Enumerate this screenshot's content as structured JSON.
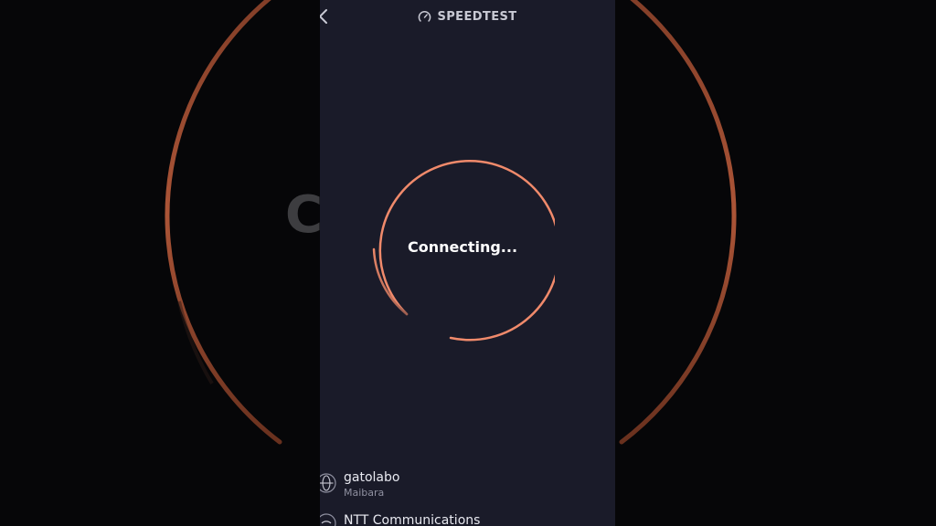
{
  "header": {
    "brand": "SPEEDTEST",
    "back_icon": "chevron-left-icon",
    "logo_icon": "gauge-icon"
  },
  "test": {
    "status": "Connecting...",
    "ring_color": "#f08a6b"
  },
  "server": {
    "host": "gatolabo",
    "location": "Maibara",
    "icon": "globe-icon"
  },
  "isp": {
    "name": "NTT Communications",
    "icon": "wifi-icon"
  },
  "background": {
    "letter": "C",
    "ring_color": "#b55a3c"
  }
}
